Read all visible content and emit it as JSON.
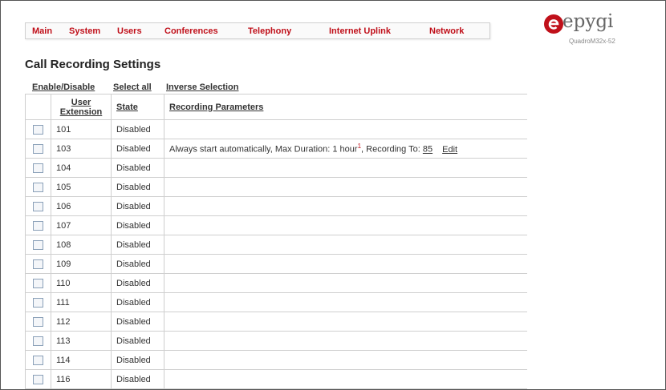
{
  "nav": {
    "items": [
      "Main",
      "System",
      "Users",
      "Conferences",
      "Telephony",
      "Internet Uplink",
      "Network"
    ],
    "accent": "#c0101a"
  },
  "logo": {
    "word": "epygi",
    "model": "QuadroM32x-52",
    "mark_color": "#c0101a"
  },
  "page": {
    "title": "Call Recording Settings"
  },
  "actions": {
    "enable_disable": "Enable/Disable",
    "select_all": "Select all",
    "inverse_selection": "Inverse Selection"
  },
  "table": {
    "headers": {
      "extension_line1": "User",
      "extension_line2": "Extension",
      "state": "State",
      "params": "Recording Parameters"
    },
    "rows": [
      {
        "ext": "101",
        "state": "Disabled",
        "params": ""
      },
      {
        "ext": "103",
        "state": "Disabled",
        "params": "Always start automatically, Max Duration: 1 hour",
        "sup": "1",
        "record_to_label": ", Recording To:",
        "record_to": "85",
        "edit": "Edit"
      },
      {
        "ext": "104",
        "state": "Disabled",
        "params": ""
      },
      {
        "ext": "105",
        "state": "Disabled",
        "params": ""
      },
      {
        "ext": "106",
        "state": "Disabled",
        "params": ""
      },
      {
        "ext": "107",
        "state": "Disabled",
        "params": ""
      },
      {
        "ext": "108",
        "state": "Disabled",
        "params": ""
      },
      {
        "ext": "109",
        "state": "Disabled",
        "params": ""
      },
      {
        "ext": "110",
        "state": "Disabled",
        "params": ""
      },
      {
        "ext": "111",
        "state": "Disabled",
        "params": ""
      },
      {
        "ext": "112",
        "state": "Disabled",
        "params": ""
      },
      {
        "ext": "113",
        "state": "Disabled",
        "params": ""
      },
      {
        "ext": "114",
        "state": "Disabled",
        "params": ""
      },
      {
        "ext": "116",
        "state": "Disabled",
        "params": ""
      }
    ]
  }
}
